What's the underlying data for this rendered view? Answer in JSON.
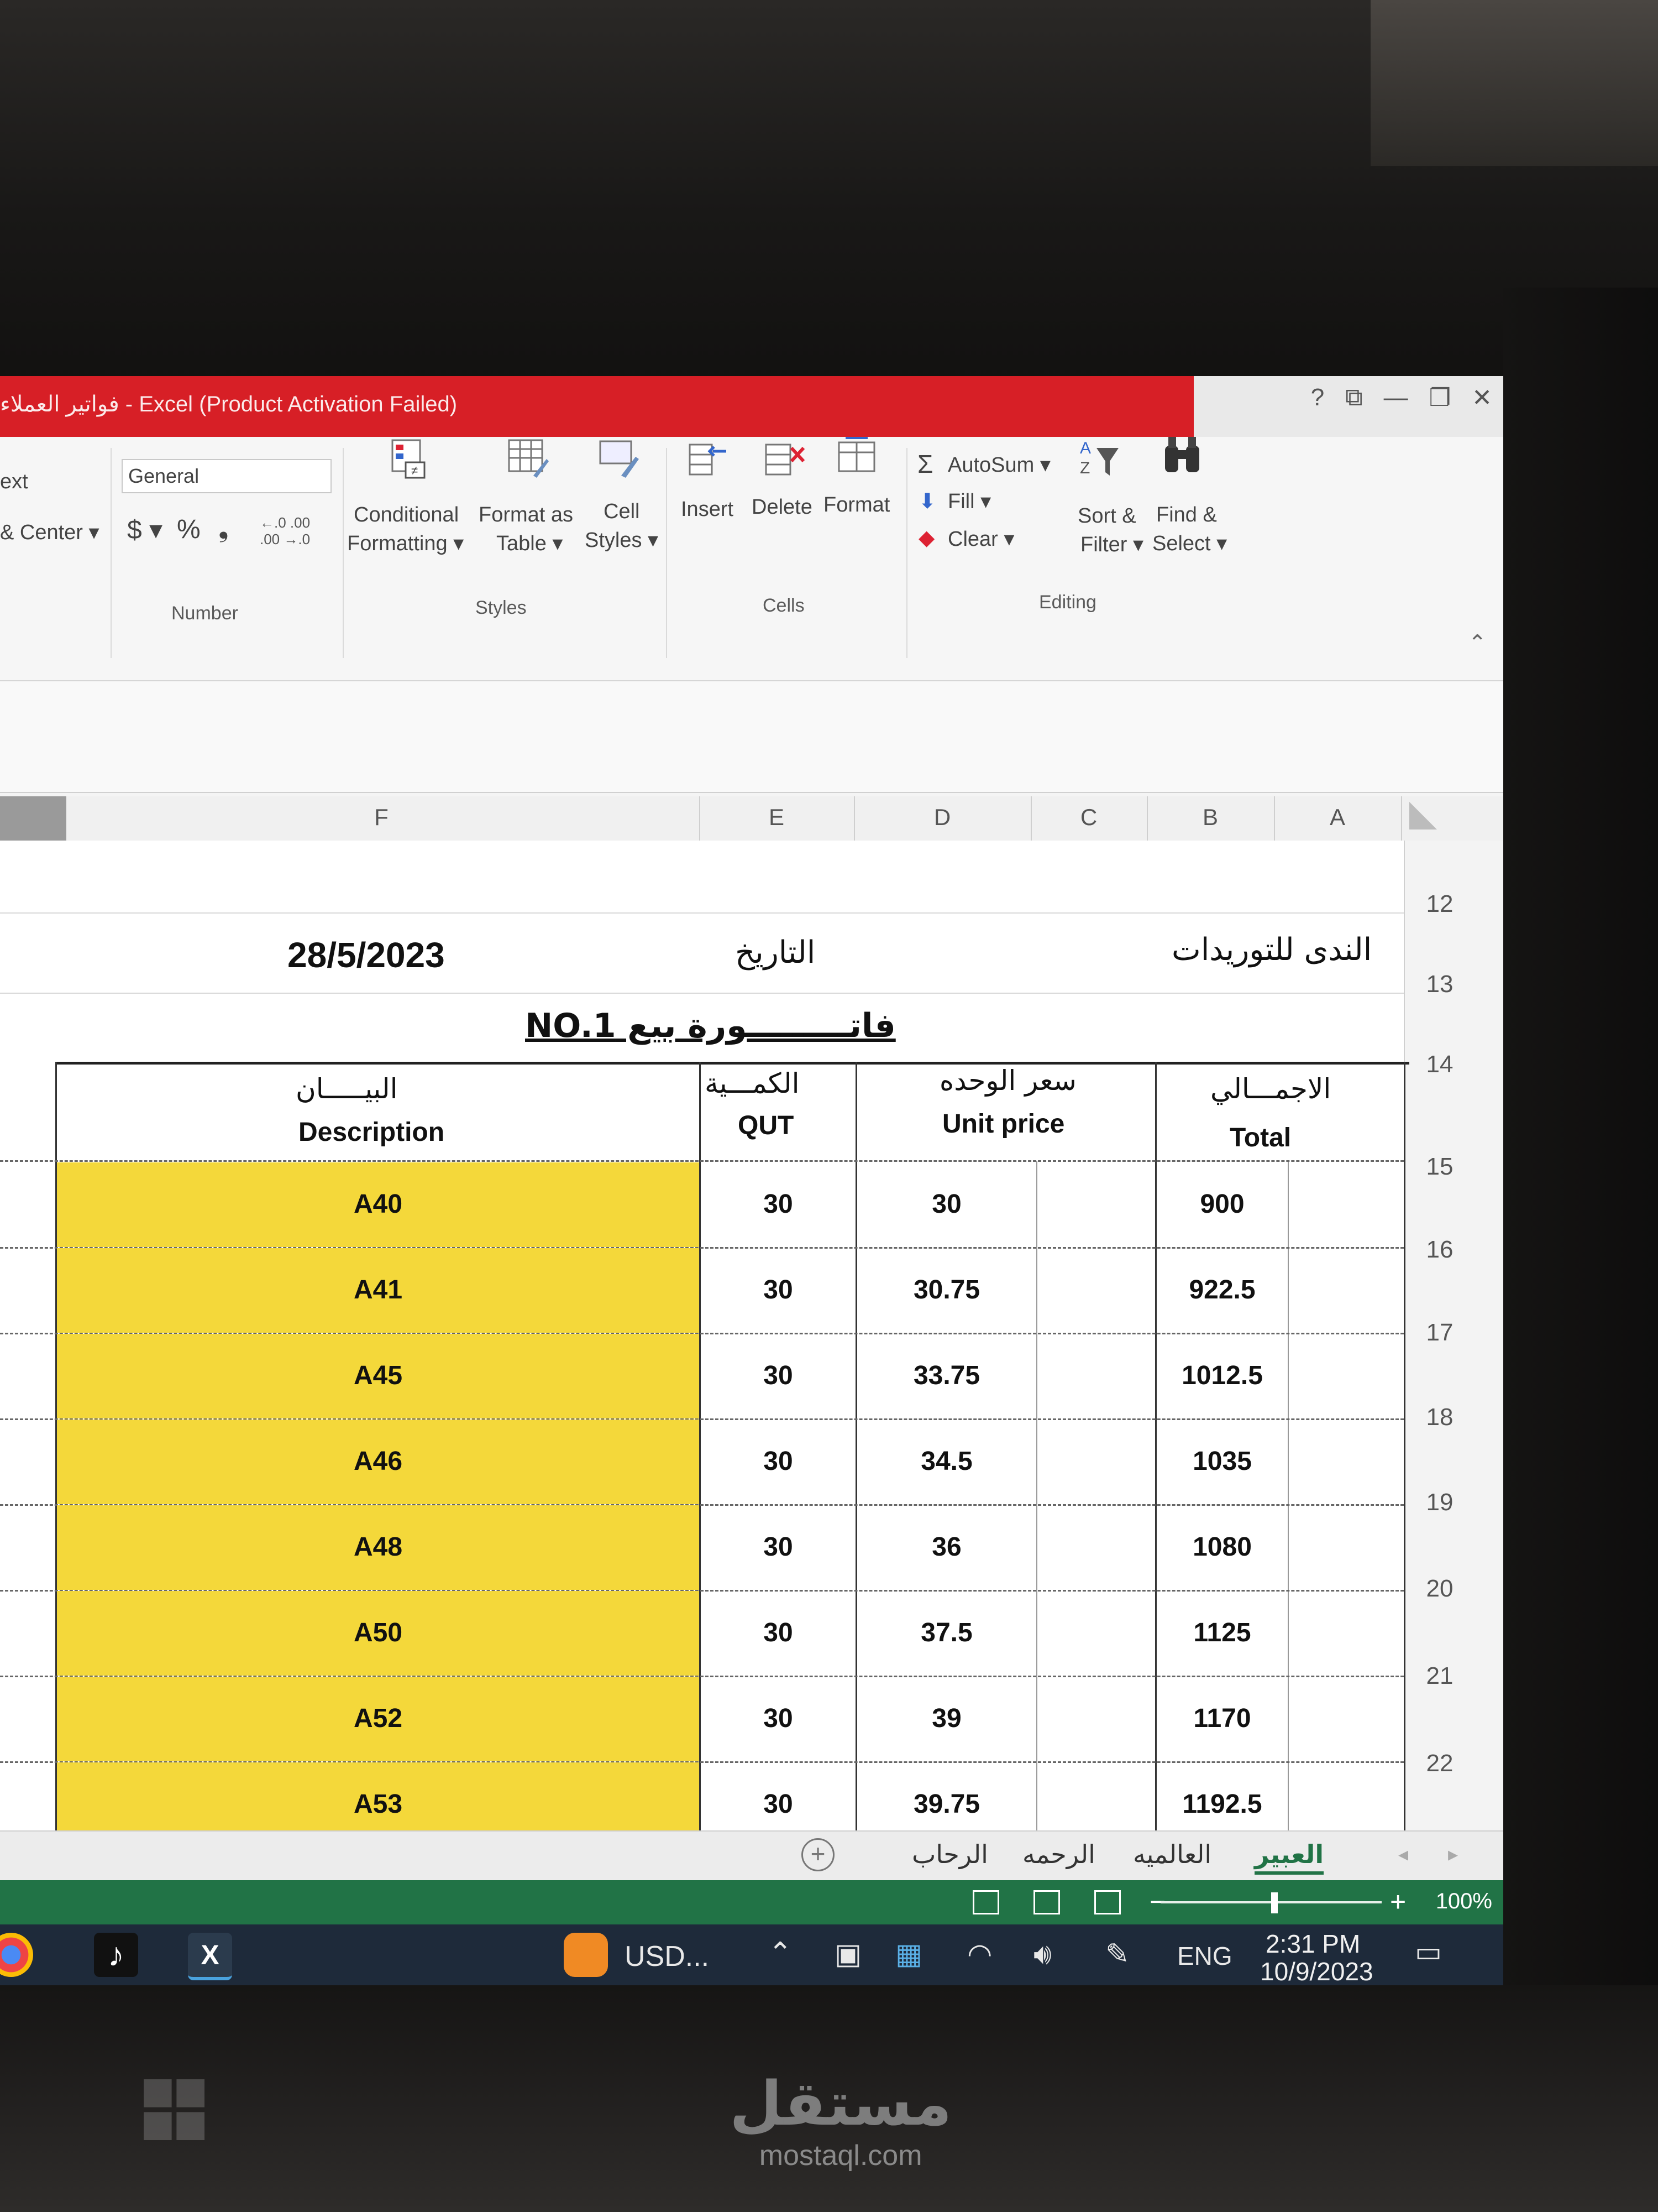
{
  "window": {
    "title": "فواتير العملاء - Excel (Product Activation Failed)",
    "help": "?",
    "restore": "⧉",
    "minimize": "—",
    "maximize": "❐",
    "close": "✕"
  },
  "ribbon": {
    "alignment": {
      "wrap_text": "ext",
      "merge_center": "& Center ▾"
    },
    "number": {
      "format_value": "General",
      "currency": "$ ▾",
      "percent": "%",
      "comma": "❟",
      "inc_decimal": "←.0 .00",
      "dec_decimal": ".00 →.0",
      "group_label": "Number"
    },
    "styles": {
      "conditional": "Conditional",
      "conditional2": "Formatting ▾",
      "format_table": "Format as",
      "format_table2": "Table ▾",
      "cell_styles": "Cell",
      "cell_styles2": "Styles ▾",
      "group_label": "Styles"
    },
    "cells": {
      "insert": "Insert",
      "delete": "Delete",
      "format": "Format",
      "group_label": "Cells"
    },
    "editing": {
      "autosum": "AutoSum ▾",
      "fill": "Fill ▾",
      "clear": "Clear ▾",
      "sort": "Sort &",
      "sort2": "Filter ▾",
      "find": "Find &",
      "find2": "Select ▾",
      "group_label": "Editing"
    }
  },
  "columns": [
    "F",
    "E",
    "D",
    "C",
    "B",
    "A"
  ],
  "rows": [
    "12",
    "13",
    "14",
    "15",
    "16",
    "17",
    "18",
    "19",
    "20",
    "21",
    "22"
  ],
  "sheet": {
    "company": "الندى للتوريدات",
    "date_label": "التاريخ",
    "date_value": "28/5/2023",
    "invoice_title": "فاتـــــــــورة بيع NO.1",
    "headers": {
      "description_ar": "البيـــــان",
      "description_en": "Description",
      "qty_ar": "الكمـــية",
      "qty_en": "QUT",
      "unit_ar": "سعر الوحده",
      "unit_en": "Unit price",
      "total_ar": "الاجمـــالي",
      "total_en": "Total"
    },
    "items": [
      {
        "description": "A40",
        "qty": "30",
        "unit_price": "30",
        "total": "900"
      },
      {
        "description": "A41",
        "qty": "30",
        "unit_price": "30.75",
        "total": "922.5"
      },
      {
        "description": "A45",
        "qty": "30",
        "unit_price": "33.75",
        "total": "1012.5"
      },
      {
        "description": "A46",
        "qty": "30",
        "unit_price": "34.5",
        "total": "1035"
      },
      {
        "description": "A48",
        "qty": "30",
        "unit_price": "36",
        "total": "1080"
      },
      {
        "description": "A50",
        "qty": "30",
        "unit_price": "37.5",
        "total": "1125"
      },
      {
        "description": "A52",
        "qty": "30",
        "unit_price": "39",
        "total": "1170"
      },
      {
        "description": "A53",
        "qty": "30",
        "unit_price": "39.75",
        "total": "1192.5"
      }
    ]
  },
  "tabs": [
    "العبير",
    "العالميه",
    "الرحمه",
    "الرحاب"
  ],
  "active_tab": "العبير",
  "status": {
    "zoom": "100%",
    "zoom_level": 1.0
  },
  "taskbar": {
    "currency": "USD...",
    "language": "ENG",
    "time": "2:31 PM",
    "date": "10/9/2023",
    "excel_label": "X"
  },
  "watermark": {
    "arabic": "مستقل",
    "latin": "mostaql.com"
  },
  "colors": {
    "title_red": "#d71f26",
    "excel_green": "#217346",
    "highlight": "#f4d83a"
  }
}
